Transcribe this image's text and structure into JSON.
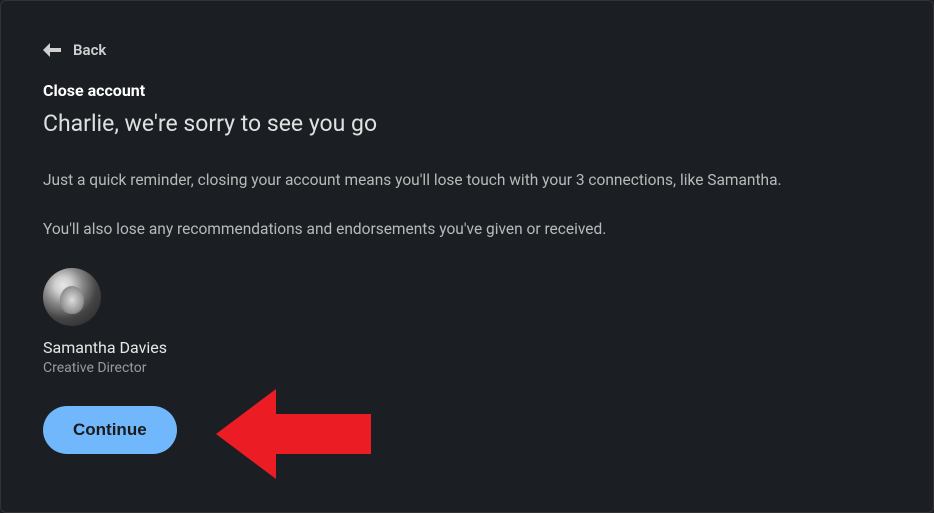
{
  "nav": {
    "back_label": "Back"
  },
  "header": {
    "section_title": "Close account",
    "headline": "Charlie, we're sorry to see you go"
  },
  "body": {
    "reminder_line": "Just a quick reminder, closing your account means you'll lose touch with your 3 connections, like Samantha.",
    "lose_line": "You'll also lose any recommendations and endorsements you've given or received."
  },
  "connection": {
    "name": "Samantha Davies",
    "role": "Creative Director"
  },
  "actions": {
    "continue_label": "Continue"
  }
}
